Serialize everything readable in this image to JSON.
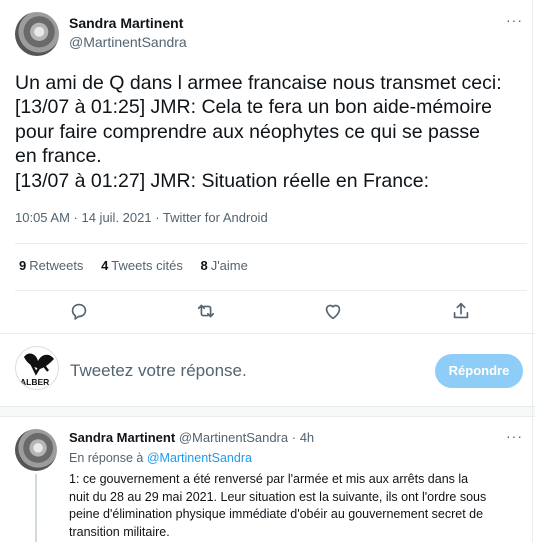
{
  "tweet": {
    "cut_top_text": "",
    "author_name": "Sandra Martinent",
    "author_handle": "@MartinentSandra",
    "more_icon": "···",
    "text_lines": [
      "Un ami de Q dans l armee francaise nous transmet ceci:",
      "[13/07 à 01:25] JMR:  Cela te fera un bon aide-mémoire",
      "pour faire comprendre aux néophytes ce qui se passe",
      "en france.",
      "[13/07 à 01:27] JMR: Situation réelle en France:"
    ],
    "meta": "10:05 AM · 14 juil. 2021 · Twitter for Android",
    "stats": {
      "retweets_count": "9",
      "retweets_label": "Retweets",
      "quotes_count": "4",
      "quotes_label": "Tweets cités",
      "likes_count": "8",
      "likes_label": "J'aime"
    },
    "actions": [
      "reply-icon",
      "retweet-icon",
      "like-icon",
      "share-icon"
    ]
  },
  "reply_box": {
    "avatar_text": "ALBER",
    "placeholder": "Tweetez votre réponse.",
    "button_label": "Répondre",
    "button_color": "#8ecdf7"
  },
  "reply": {
    "author_name": "Sandra Martinent",
    "author_handle": "@MartinentSandra",
    "time": "· 4h",
    "more_icon": "···",
    "in_reply_prefix": "En réponse à",
    "in_reply_handle": "@MartinentSandra",
    "text_lines": [
      "1: ce gouvernement a été   renversé par l'armée et mis aux arrêts dans la",
      "nuit du 28 au 29 mai 2021. Leur situation est la suivante, ils  ont l'ordre sous",
      "peine d'élimination physique immédiate d'obéir au gouvernement secret de",
      "transition militaire."
    ]
  },
  "colors": {
    "accent": "#1d9bf0",
    "secondary_text": "#536471",
    "border": "#e6ecf0"
  }
}
